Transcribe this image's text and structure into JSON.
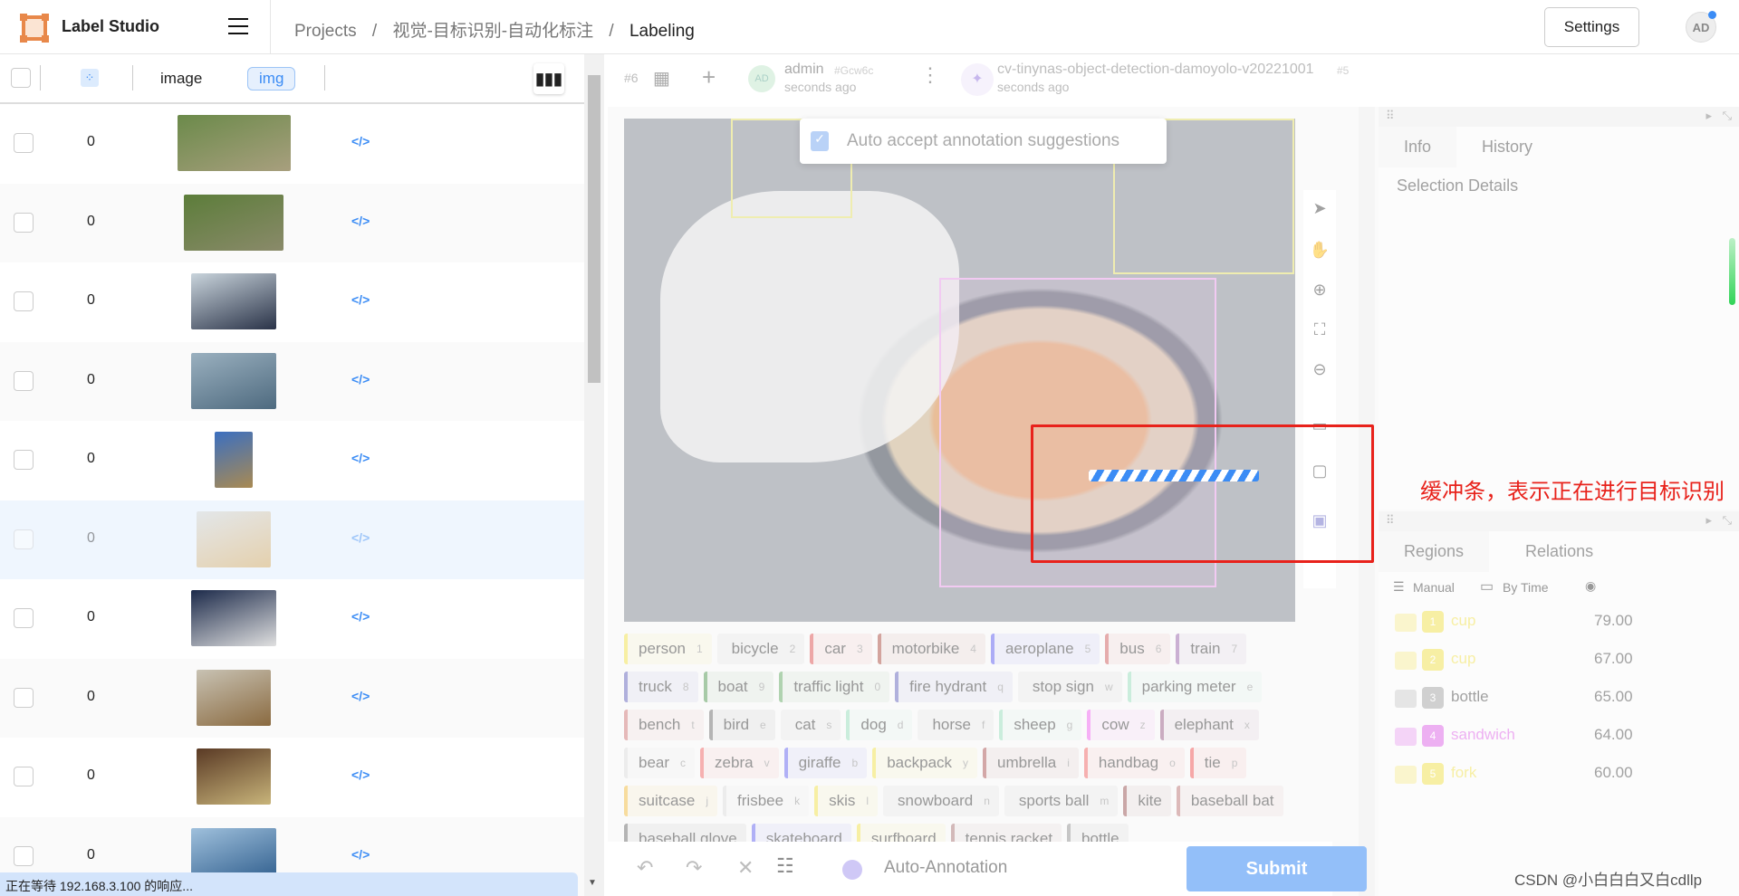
{
  "header": {
    "app_title": "Label Studio",
    "breadcrumb": [
      "Projects",
      "/",
      "视觉-目标识别-自动化标注",
      "/",
      "Labeling"
    ],
    "settings_label": "Settings",
    "avatar_initials": "AD"
  },
  "toolbar": {
    "column_image": "image",
    "column_tag": "img"
  },
  "tasks": [
    {
      "count": "0",
      "thumb": [
        "#6b8a4a",
        "#a89f7e"
      ],
      "w": 125,
      "code": "</>"
    },
    {
      "count": "0",
      "thumb": [
        "#5c7d3a",
        "#8a8a6a"
      ],
      "w": 110,
      "code": "</>"
    },
    {
      "count": "0",
      "thumb": [
        "#c9d4dc",
        "#2a3348"
      ],
      "w": 94,
      "code": "</>"
    },
    {
      "count": "0",
      "thumb": [
        "#9ab0bf",
        "#4e6a7f"
      ],
      "w": 94,
      "code": "</>"
    },
    {
      "count": "0",
      "thumb": [
        "#3b6fc0",
        "#a98a52"
      ],
      "w": 42,
      "code": "</>"
    },
    {
      "count": "0",
      "thumb": [
        "#d4d4d0",
        "#d8a24a"
      ],
      "w": 82,
      "code": "</>"
    },
    {
      "count": "0",
      "thumb": [
        "#1c2a4a",
        "#e0e0e0"
      ],
      "w": 94,
      "code": "</>"
    },
    {
      "count": "0",
      "thumb": [
        "#c8c2b3",
        "#8a6a40"
      ],
      "w": 82,
      "code": "</>"
    },
    {
      "count": "0",
      "thumb": [
        "#5a3a25",
        "#c8b47a"
      ],
      "w": 82,
      "code": "</>"
    },
    {
      "count": "0",
      "thumb": [
        "#9fc0dc",
        "#2b5a8a"
      ],
      "w": 94,
      "code": "</>"
    }
  ],
  "selected_task_index": 5,
  "status_text": "正在等待 192.168.3.100 的响应...",
  "labeling": {
    "task_id": "#6",
    "annotator": "admin",
    "annotation_id": "#Gcw6c",
    "annotator_time": "seconds ago",
    "annotator_avatar": "AD",
    "prediction_model": "cv-tinynas-object-detection-damoyolo-v20221001",
    "prediction_id": "#5",
    "prediction_time": "seconds ago",
    "auto_accept_label": "Auto accept annotation suggestions",
    "auto_accept_checked": true,
    "auto_annotation_label": "Auto-Annotation",
    "submit_label": "Submit"
  },
  "labels": [
    {
      "name": "person",
      "key": "1",
      "color": "#f2e35a"
    },
    {
      "name": "bicycle",
      "key": "2",
      "color": ""
    },
    {
      "name": "car",
      "key": "3",
      "color": "#e06060"
    },
    {
      "name": "motorbike",
      "key": "4",
      "color": "#b05a50"
    },
    {
      "name": "aeroplane",
      "key": "5",
      "color": "#6a6af0"
    },
    {
      "name": "bus",
      "key": "6",
      "color": "#d06a6a"
    },
    {
      "name": "train",
      "key": "7",
      "color": "#a070b0"
    },
    {
      "name": "truck",
      "key": "8",
      "color": "#7070c0"
    },
    {
      "name": "boat",
      "key": "9",
      "color": "#60a060"
    },
    {
      "name": "traffic light",
      "key": "0",
      "color": "#70b070"
    },
    {
      "name": "fire hydrant",
      "key": "q",
      "color": "#7070c0"
    },
    {
      "name": "stop sign",
      "key": "w",
      "color": ""
    },
    {
      "name": "parking meter",
      "key": "e",
      "color": "#a0e0c0"
    },
    {
      "name": "bench",
      "key": "t",
      "color": "#d08080"
    },
    {
      "name": "bird",
      "key": "e",
      "color": "#777777"
    },
    {
      "name": "cat",
      "key": "s",
      "color": ""
    },
    {
      "name": "dog",
      "key": "d",
      "color": "#a0e0c0"
    },
    {
      "name": "horse",
      "key": "f",
      "color": ""
    },
    {
      "name": "sheep",
      "key": "g",
      "color": "#a0e0c0"
    },
    {
      "name": "cow",
      "key": "z",
      "color": "#f070f0"
    },
    {
      "name": "elephant",
      "key": "x",
      "color": "#a06a90"
    },
    {
      "name": "bear",
      "key": "c",
      "color": "#dddddd"
    },
    {
      "name": "zebra",
      "key": "v",
      "color": "#f07070"
    },
    {
      "name": "giraffe",
      "key": "b",
      "color": "#7070f0"
    },
    {
      "name": "backpack",
      "key": "y",
      "color": "#f2e35a"
    },
    {
      "name": "umbrella",
      "key": "i",
      "color": "#b06060"
    },
    {
      "name": "handbag",
      "key": "o",
      "color": "#f07070"
    },
    {
      "name": "tie",
      "key": "p",
      "color": "#f06060"
    },
    {
      "name": "suitcase",
      "key": "j",
      "color": "#f2c050"
    },
    {
      "name": "frisbee",
      "key": "k",
      "color": "#dddddd"
    },
    {
      "name": "skis",
      "key": "l",
      "color": "#f2e35a"
    },
    {
      "name": "snowboard",
      "key": "n",
      "color": ""
    },
    {
      "name": "sports ball",
      "key": "m",
      "color": ""
    },
    {
      "name": "kite",
      "key": "",
      "color": "#a06060"
    },
    {
      "name": "baseball bat",
      "key": "",
      "color": "#c08080"
    },
    {
      "name": "baseball glove",
      "key": "",
      "color": "#777777"
    },
    {
      "name": "skateboard",
      "key": "",
      "color": "#7070f0"
    },
    {
      "name": "surfboard",
      "key": "",
      "color": "#f2e35a"
    },
    {
      "name": "tennis racket",
      "key": "",
      "color": "#b08080"
    },
    {
      "name": "bottle",
      "key": "",
      "color": "#999999"
    }
  ],
  "side_panel": {
    "tabs": [
      "Info",
      "History"
    ],
    "selection_details": "Selection Details",
    "region_tabs": [
      "Regions",
      "Relations"
    ],
    "sort_manual": "Manual",
    "sort_by_time": "By Time"
  },
  "regions": [
    {
      "index": "1",
      "label": "cup",
      "score": "79.00",
      "color": "#f2e35a"
    },
    {
      "index": "2",
      "label": "cup",
      "score": "67.00",
      "color": "#f2e35a"
    },
    {
      "index": "3",
      "label": "bottle",
      "score": "65.00",
      "color": "#aaaaaa"
    },
    {
      "index": "4",
      "label": "sandwich",
      "score": "64.00",
      "color": "#e070e8"
    },
    {
      "index": "5",
      "label": "fork",
      "score": "60.00",
      "color": "#f2e35a"
    }
  ],
  "annotation": {
    "note": "缓冲条，表示正在进行目标识别",
    "watermark": "CSDN @小白白白又白cdllp"
  }
}
